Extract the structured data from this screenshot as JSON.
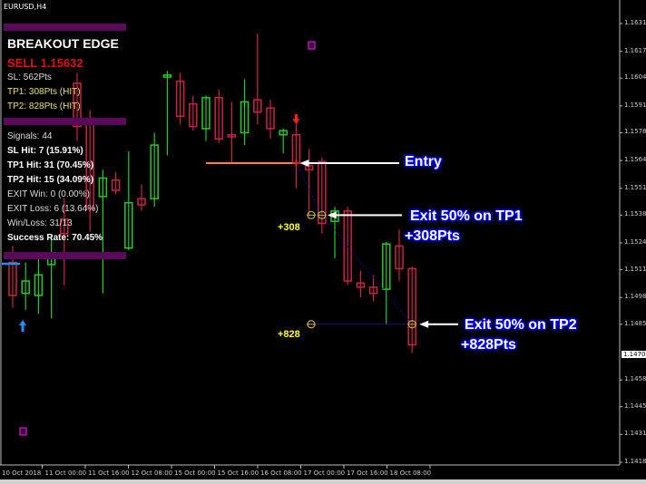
{
  "window": {
    "symbol_title": "EURUSD,H4"
  },
  "panel": {
    "title": "BREAKOUT EDGE",
    "signal": "SELL 1.15632",
    "sl": "SL: 562Pts",
    "tp1": "TP1: 308Pts (HIT)",
    "tp2": "TP2: 828Pts (HIT)",
    "stats": {
      "signals": "Signals: 44",
      "sl_hit": "SL Hit: 7 (15.91%)",
      "tp1_hit": "TP1 Hit: 31 (70.45%)",
      "tp2_hit": "TP2 Hit: 15 (34.09%)",
      "exit_win": "EXIT Win: 0 (0.00%)",
      "exit_loss": "EXIT Loss: 6 (13.64%)",
      "win_loss": "Win/Loss: 31/13",
      "success_rate": "Success Rate: 70.45%"
    }
  },
  "annotations": {
    "entry": "Entry",
    "tp1_line1": "Exit 50% on TP1",
    "tp1_line2": "+308Pts",
    "tp2_line1": "Exit 50% on TP2",
    "tp2_line2": "+828Pts",
    "tp1_marker": "+308",
    "tp2_marker": "+828"
  },
  "colors": {
    "bull": "#22cc22",
    "bear": "#cc2244",
    "entry_line": "#ff8040",
    "panel_bar": "#5a0a5a",
    "tp_line": "#101080",
    "up_arrow": "#2090ff",
    "down_arrow": "#ff2020"
  },
  "price_axis": {
    "labels": [
      "1.16310",
      "1.16175",
      "1.16045",
      "1.15910",
      "1.15780",
      "1.15645",
      "1.15510",
      "1.15380",
      "1.15245",
      "1.15115",
      "1.14980",
      "1.14850",
      "1.14580",
      "1.14450",
      "1.14315",
      "1.14180"
    ],
    "current_price": "1.14706"
  },
  "time_axis": {
    "labels": [
      "10 Oct 2018",
      "11 Oct 00:00",
      "11 Oct 16:00",
      "12 Oct 08:00",
      "15 Oct 00:00",
      "15 Oct 16:00",
      "16 Oct 08:00",
      "17 Oct 00:00",
      "17 Oct 16:00",
      "18 Oct 08:00"
    ]
  },
  "chart_data": {
    "type": "candlestick",
    "symbol": "EURUSD",
    "timeframe": "H4",
    "ylim": [
      1.1418,
      1.1631
    ],
    "entry_price": 1.15632,
    "tp1_price": 1.1538,
    "tp2_price": 1.1485,
    "candles": [
      {
        "o": 1.1515,
        "h": 1.1523,
        "l": 1.1493,
        "c": 1.1499
      },
      {
        "o": 1.15,
        "h": 1.1515,
        "l": 1.1492,
        "c": 1.1506
      },
      {
        "o": 1.1499,
        "h": 1.1518,
        "l": 1.149,
        "c": 1.1509
      },
      {
        "o": 1.1514,
        "h": 1.1528,
        "l": 1.1488,
        "c": 1.1519
      },
      {
        "o": 1.1536,
        "h": 1.1546,
        "l": 1.1504,
        "c": 1.1529
      },
      {
        "o": 1.1602,
        "h": 1.1607,
        "l": 1.1574,
        "c": 1.1581
      },
      {
        "o": 1.1585,
        "h": 1.1589,
        "l": 1.153,
        "c": 1.1541
      },
      {
        "o": 1.1547,
        "h": 1.156,
        "l": 1.15,
        "c": 1.1556
      },
      {
        "o": 1.1555,
        "h": 1.1559,
        "l": 1.1548,
        "c": 1.155
      },
      {
        "o": 1.1522,
        "h": 1.1569,
        "l": 1.1521,
        "c": 1.1544
      },
      {
        "o": 1.1546,
        "h": 1.1553,
        "l": 1.154,
        "c": 1.1543
      },
      {
        "o": 1.1546,
        "h": 1.1578,
        "l": 1.1542,
        "c": 1.1572
      },
      {
        "o": 1.1605,
        "h": 1.1608,
        "l": 1.1567,
        "c": 1.1606
      },
      {
        "o": 1.1603,
        "h": 1.1607,
        "l": 1.1582,
        "c": 1.1586
      },
      {
        "o": 1.1592,
        "h": 1.1596,
        "l": 1.1579,
        "c": 1.1581
      },
      {
        "o": 1.158,
        "h": 1.1596,
        "l": 1.1574,
        "c": 1.1595
      },
      {
        "o": 1.1595,
        "h": 1.1599,
        "l": 1.1573,
        "c": 1.1575
      },
      {
        "o": 1.1577,
        "h": 1.1593,
        "l": 1.1563,
        "c": 1.1576
      },
      {
        "o": 1.1578,
        "h": 1.1604,
        "l": 1.1572,
        "c": 1.1593
      },
      {
        "o": 1.1594,
        "h": 1.1626,
        "l": 1.1582,
        "c": 1.1588
      },
      {
        "o": 1.159,
        "h": 1.1594,
        "l": 1.1575,
        "c": 1.158
      },
      {
        "o": 1.1577,
        "h": 1.158,
        "l": 1.1568,
        "c": 1.1579
      },
      {
        "o": 1.1577,
        "h": 1.1582,
        "l": 1.1551,
        "c": 1.15632
      },
      {
        "o": 1.1562,
        "h": 1.157,
        "l": 1.1538,
        "c": 1.156
      },
      {
        "o": 1.1564,
        "h": 1.1566,
        "l": 1.1529,
        "c": 1.1534
      },
      {
        "o": 1.1535,
        "h": 1.1542,
        "l": 1.1517,
        "c": 1.154
      },
      {
        "o": 1.154,
        "h": 1.1542,
        "l": 1.1504,
        "c": 1.1506
      },
      {
        "o": 1.1505,
        "h": 1.1511,
        "l": 1.1498,
        "c": 1.1503
      },
      {
        "o": 1.1503,
        "h": 1.1509,
        "l": 1.1496,
        "c": 1.15
      },
      {
        "o": 1.1502,
        "h": 1.1525,
        "l": 1.1485,
        "c": 1.1524
      },
      {
        "o": 1.1523,
        "h": 1.1531,
        "l": 1.1506,
        "c": 1.1512
      },
      {
        "o": 1.1512,
        "h": 1.1513,
        "l": 1.1471,
        "c": 1.1475
      }
    ]
  }
}
